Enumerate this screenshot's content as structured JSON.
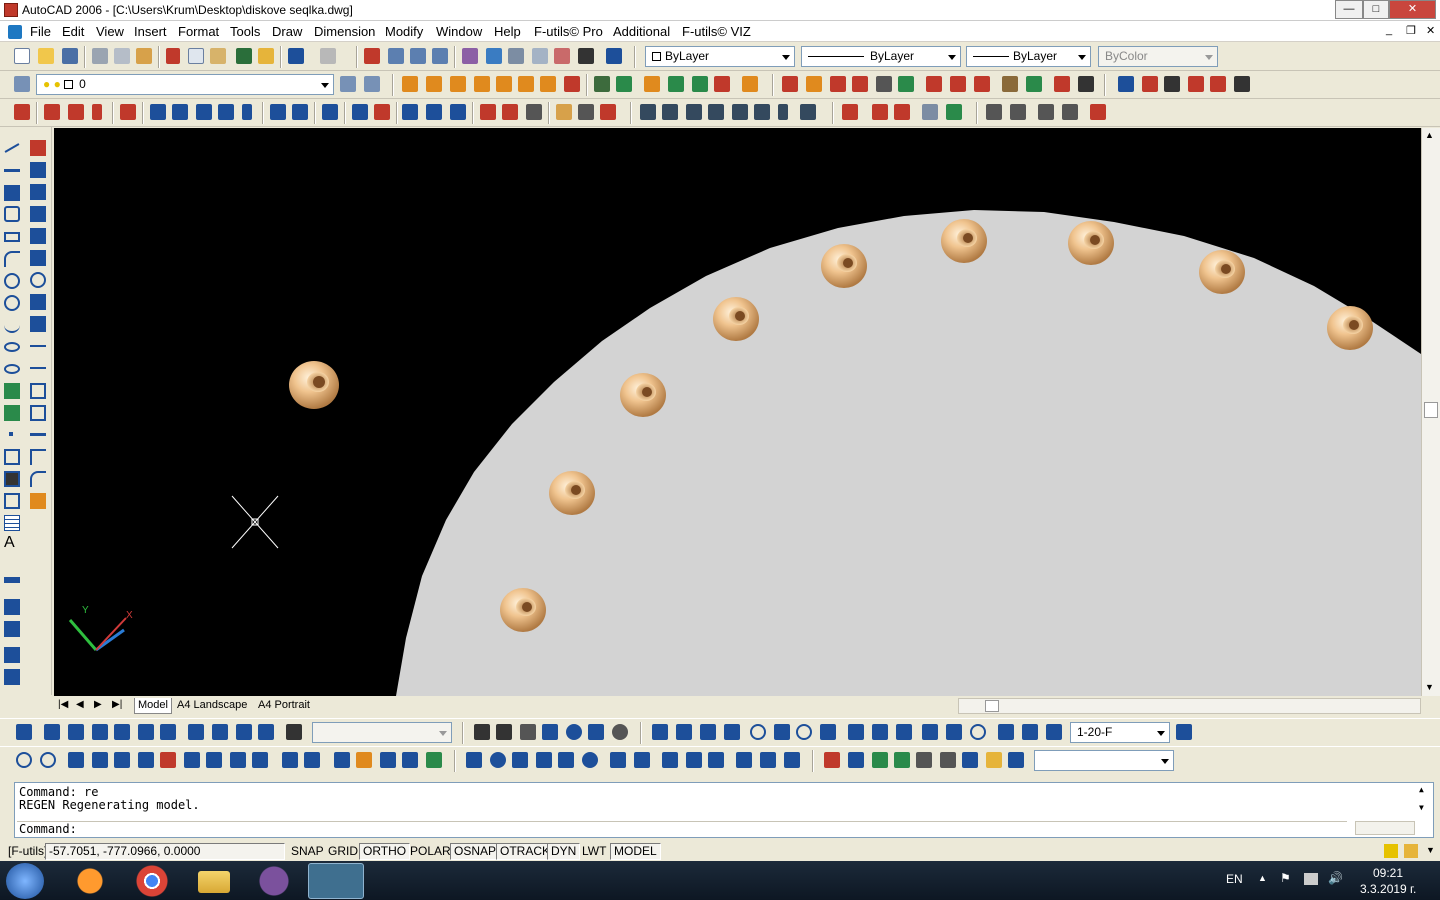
{
  "window": {
    "title": "AutoCAD 2006 - [C:\\Users\\Krum\\Desktop\\diskove seqlka.dwg]",
    "min": "—",
    "max": "□",
    "close": "✕"
  },
  "menu": [
    "File",
    "Edit",
    "View",
    "Insert",
    "Format",
    "Tools",
    "Draw",
    "Dimension",
    "Modify",
    "Window",
    "Help",
    "F-utils© Pro",
    "Additional",
    "F-utils© VIZ"
  ],
  "properties": {
    "color": "ByLayer",
    "linetype": "ByLayer",
    "lineweight": "ByLayer",
    "plotstyle": "ByColor",
    "layer": "0"
  },
  "dimstyle": {
    "value": "1-20-F"
  },
  "layout_tabs": [
    "Model",
    "A4 Landscape",
    "A4 Portrait"
  ],
  "command": {
    "line1": "Command: re",
    "line2": "REGEN Regenerating model.",
    "prompt": "Command:"
  },
  "status": {
    "label": "[F-utils]",
    "coords": "-57.7051, -777.0966, 0.0000",
    "toggles": [
      "SNAP",
      "GRID",
      "ORTHO",
      "POLAR",
      "OSNAP",
      "OTRACK",
      "DYN",
      "LWT",
      "MODEL"
    ]
  },
  "ucs": {
    "x": "X",
    "y": "Y"
  },
  "taskbar": {
    "lang": "EN",
    "time": "09:21",
    "date": "3.3.2019 г."
  },
  "colors": {
    "canvas": "#000000",
    "disc": "#d3d3d3",
    "nut": "#e0a86e",
    "accent": "#c9463d"
  }
}
